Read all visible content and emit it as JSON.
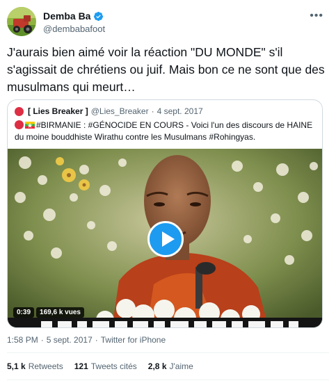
{
  "author": {
    "display_name": "Demba Ba",
    "handle": "@dembabafoot"
  },
  "tweet": {
    "text": "J'aurais bien aimé voir la réaction \"DU MONDE\" s'il s'agissait de chrétiens ou  juif. Mais bon ce ne sont que des musulmans qui meurt…",
    "time": "1:58 PM",
    "separator": "·",
    "date": "5 sept. 2017",
    "source": "Twitter for iPhone"
  },
  "quoted": {
    "display_name": "[ Lies Breaker ]",
    "handle": "@Lies_Breaker",
    "separator": "·",
    "date": "4 sept. 2017",
    "text_before_flag": "#BIRMANIE : #GÉNOCIDE EN COURS - Voici l'un des discours de HAINE du moine bouddhiste Wirathu contre les Musulmans #Rohingyas.",
    "video": {
      "duration": "0:39",
      "views": "169,6 k vues"
    }
  },
  "stats": {
    "retweets_count": "5,1 k",
    "retweets_label": "Retweets",
    "quotes_count": "121",
    "quotes_label": "Tweets cités",
    "likes_count": "2,8 k",
    "likes_label": "J'aime"
  },
  "icons": {
    "more": "more-icon",
    "verified": "verified-badge-icon",
    "play": "play-icon",
    "red_circle": "red-circle-emoji-icon",
    "flag": "myanmar-flag-emoji-icon"
  },
  "colors": {
    "accent": "#1d9bf0",
    "text": "#0f1419",
    "secondary": "#536471",
    "border": "#cfd9de",
    "red_circle": "#dd2e44"
  }
}
